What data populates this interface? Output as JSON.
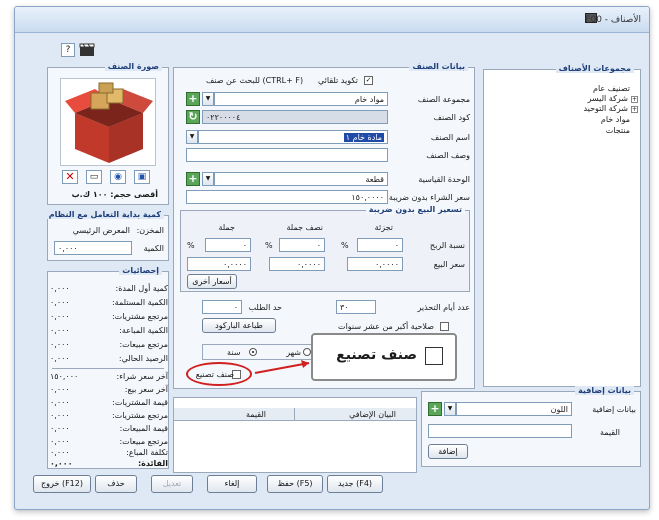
{
  "window": {
    "title": "F00 - الأصناف"
  },
  "toolbar": {
    "help_label": "?"
  },
  "image_section": {
    "title": "صورة الصنف",
    "size_text": "أقصى حجم: ١٠٠ ك.ب"
  },
  "start_qty": {
    "title": "كمية بداية التعامل مع النظام",
    "store_label": "المخزن:",
    "store_value": "المعرض الرئيسي",
    "qty_label": "الكمية",
    "qty_value": "٠,٠٠٠"
  },
  "statistics": {
    "title": "إحصائيات",
    "rows": [
      {
        "label": "كمية أول المدة:",
        "value": "٠,٠٠٠"
      },
      {
        "label": "الكمية المستلمة:",
        "value": "٠,٠٠٠"
      },
      {
        "label": "مرتجع مشتريات:",
        "value": "٠,٠٠٠"
      },
      {
        "label": "الكمية المباعة:",
        "value": "٠,٠٠٠"
      },
      {
        "label": "مرتجع مبيعات:",
        "value": "٠,٠٠٠"
      },
      {
        "label": "الرصيد الحالي:",
        "value": "٠,٠٠٠"
      },
      {
        "label": "آخر سعر شراء:",
        "value": "١٥٠,٠٠٠"
      },
      {
        "label": "آخر سعر بيع:",
        "value": "٠,٠٠٠"
      },
      {
        "label": "قيمة المشتريات:",
        "value": "٠,٠٠٠"
      },
      {
        "label": "مرتجع مشتريات:",
        "value": "٠,٠٠٠"
      },
      {
        "label": "قيمة المبيعات:",
        "value": "٠,٠٠٠"
      },
      {
        "label": "مرتجع مبيعات:",
        "value": "٠,٠٠٠"
      },
      {
        "label": "تكلفة المباع:",
        "value": "٠,٠٠٠"
      },
      {
        "label": "الفائدة:",
        "value": "٠,٠٠٠"
      }
    ]
  },
  "item_data": {
    "title": "بيانات الصنف",
    "auto_code_label": "تكويد تلقائي",
    "search_hint": "للبحث عن صنف (CTRL+ F)",
    "group_label": "مجموعة الصنف",
    "group_value": "مواد خام",
    "code_label": "كود الصنف",
    "code_value": "٠٢٢٠٠٠٠٤",
    "name_label": "اسم الصنف",
    "name_value": "مادة خام ١",
    "desc_label": "وصف الصنف",
    "desc_value": "",
    "unit_label": "الوحدة القياسية",
    "unit_value": "قطعة",
    "purchase_label": "سعر الشراء بدون ضريبة",
    "purchase_value": "١٥٠,٠٠٠٠"
  },
  "pricing": {
    "title": "تسعير البيع بدون ضريبة",
    "col_retail": "تجزئة",
    "col_half": "نصف جملة",
    "col_wholesale": "جملة",
    "profit_label": "نسبة الربح",
    "price_label": "سعر البيع",
    "percent_sign": "%",
    "retail_profit": "٠",
    "half_profit": "٠",
    "wholesale_profit": "٠",
    "retail_price": "٠,٠٠٠٠",
    "half_price": "٠,٠٠٠٠",
    "wholesale_price": "٠,٠٠٠٠",
    "other_prices_button": "أسعار أخرى"
  },
  "misc": {
    "warning_days_label": "عدد أيام التحذير",
    "warning_days_value": "٣٠",
    "reorder_label": "حد الطلب",
    "reorder_value": "٠",
    "validity_label": "صلاحية أكبر من عشر سنوات",
    "barcode_button": "طباعة الباركود",
    "year_label": "سنة",
    "month_label": "شهر",
    "manufactured_label": "صنف تصنيع",
    "callout_label": "صنف تصنيع"
  },
  "item_groups": {
    "title": "مجموعات الأصناف",
    "items": [
      "تصنيف عام",
      "شركة اليسر",
      "شركة التوحيد",
      "مواد خام",
      "منتجات"
    ]
  },
  "extra_data": {
    "title": "بيانات إضافية",
    "label": "بيانات إضافية",
    "value": "اللون",
    "value_label": "القيمة",
    "value_input": "",
    "add_button": "إضافة"
  },
  "extra_table": {
    "col_extra": "البيان الإضافي",
    "col_value": "القيمة"
  },
  "buttons": {
    "new": "جديد (F4)",
    "save": "حفظ (F5)",
    "cancel": "إلغاء",
    "edit": "تعديل",
    "delete": "حذف",
    "exit": "خروج (F12)"
  }
}
